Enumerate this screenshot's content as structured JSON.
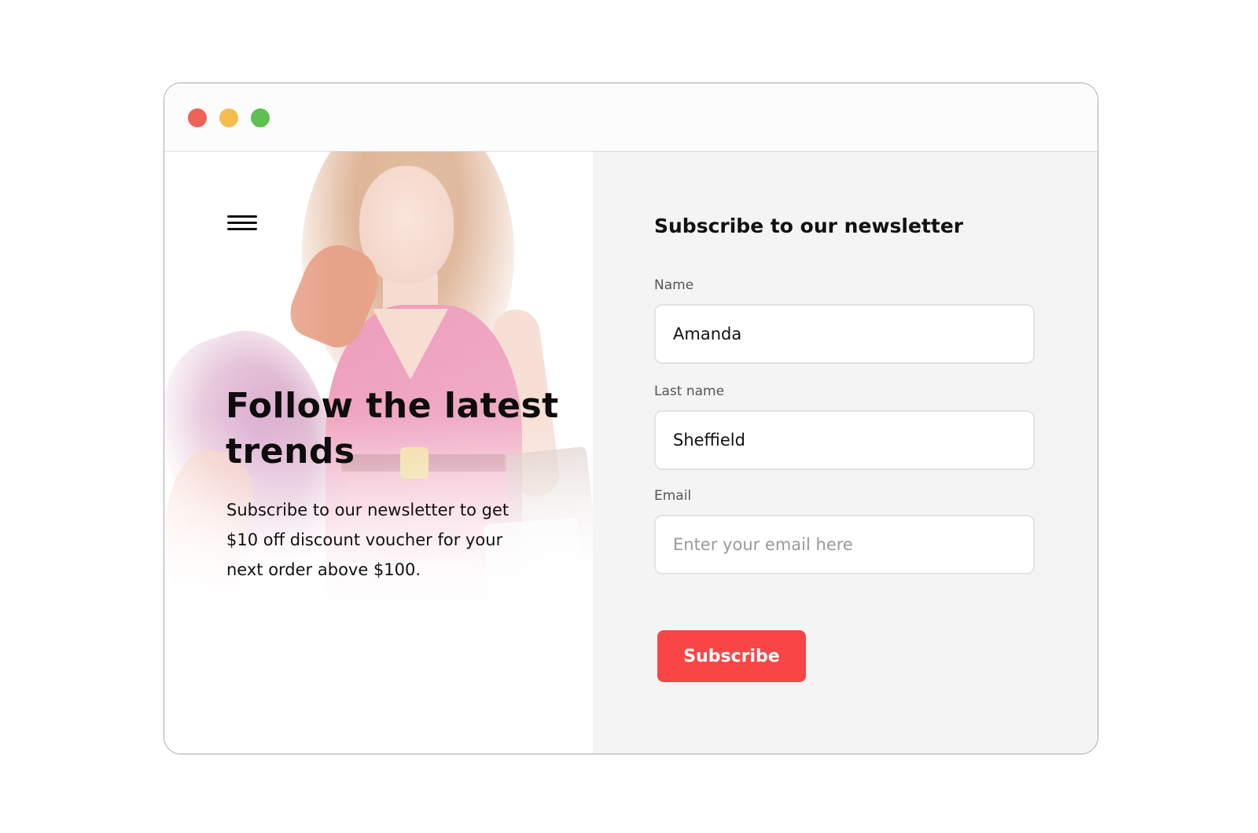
{
  "window": {
    "controls": [
      "close",
      "minimize",
      "maximize"
    ],
    "colors": {
      "close": "#ee6258",
      "minimize": "#f4bc4f",
      "maximize": "#5ec04e"
    }
  },
  "hero": {
    "menu_icon": "hamburger-menu-icon",
    "headline": "Follow the latest trends",
    "description": "Subscribe to our newsletter to get $10 off discount voucher for your next order above $100."
  },
  "form": {
    "title": "Subscribe to our newsletter",
    "fields": {
      "name": {
        "label": "Name",
        "value": "Amanda",
        "placeholder": ""
      },
      "last_name": {
        "label": "Last name",
        "value": "Sheffield",
        "placeholder": ""
      },
      "email": {
        "label": "Email",
        "value": "",
        "placeholder": "Enter your email here"
      }
    },
    "submit_label": "Subscribe"
  },
  "colors": {
    "accent": "#f94545",
    "form_background": "#f4f4f4"
  }
}
